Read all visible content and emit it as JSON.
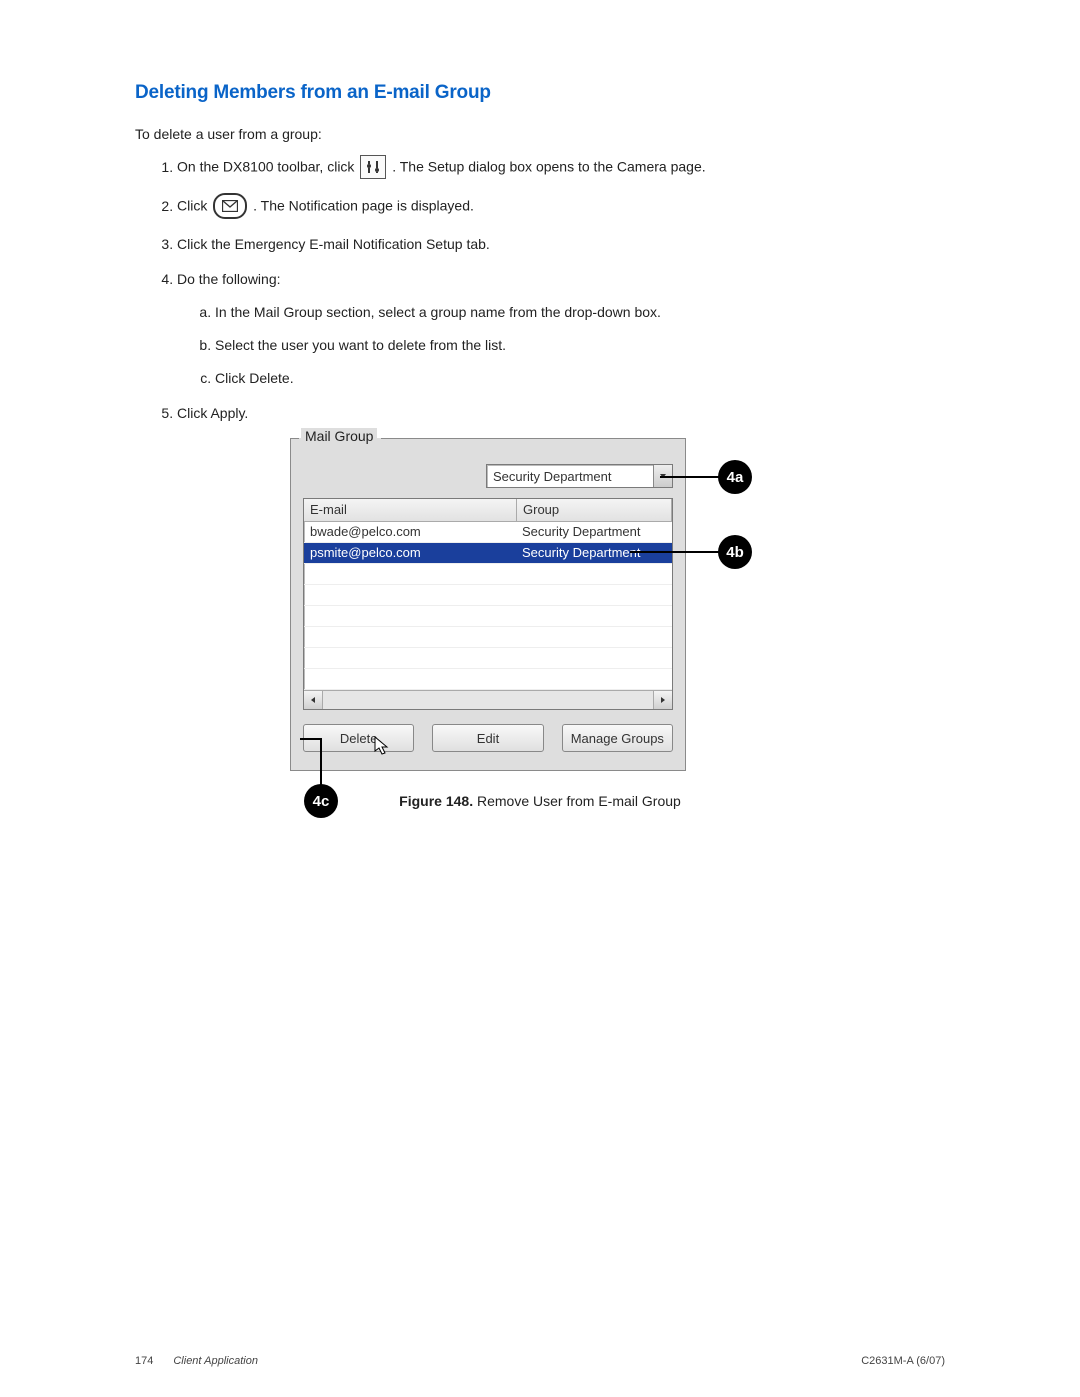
{
  "title": "Deleting Members from an E-mail Group",
  "intro": "To delete a user from a group:",
  "steps": {
    "s1_a": "On the DX8100 toolbar, click ",
    "s1_b": ". The Setup dialog box opens to the Camera page.",
    "s2_a": "Click ",
    "s2_b": ". The Notification page is displayed.",
    "s3": "Click the Emergency E-mail Notification Setup tab.",
    "s4": "Do the following:",
    "s4a": "In the Mail Group section, select a group name from the drop-down box.",
    "s4b": "Select the user you want to delete from the list.",
    "s4c": "Click Delete.",
    "s5": "Click Apply."
  },
  "mailgroup": {
    "label": "Mail Group",
    "dropdown_value": "Security Department",
    "columns": {
      "email": "E-mail",
      "group": "Group"
    },
    "rows": [
      {
        "email": "bwade@pelco.com",
        "group": "Security Department",
        "selected": false
      },
      {
        "email": "psmite@pelco.com",
        "group": "Security Department",
        "selected": true
      }
    ],
    "buttons": {
      "delete": "Delete",
      "edit": "Edit",
      "manage": "Manage Groups"
    }
  },
  "callouts": {
    "a": "4a",
    "b": "4b",
    "c": "4c"
  },
  "figure": {
    "label": "Figure 148.",
    "caption": " Remove User from E-mail Group"
  },
  "footer": {
    "page": "174",
    "app": "Client Application",
    "doc": "C2631M-A (6/07)"
  }
}
